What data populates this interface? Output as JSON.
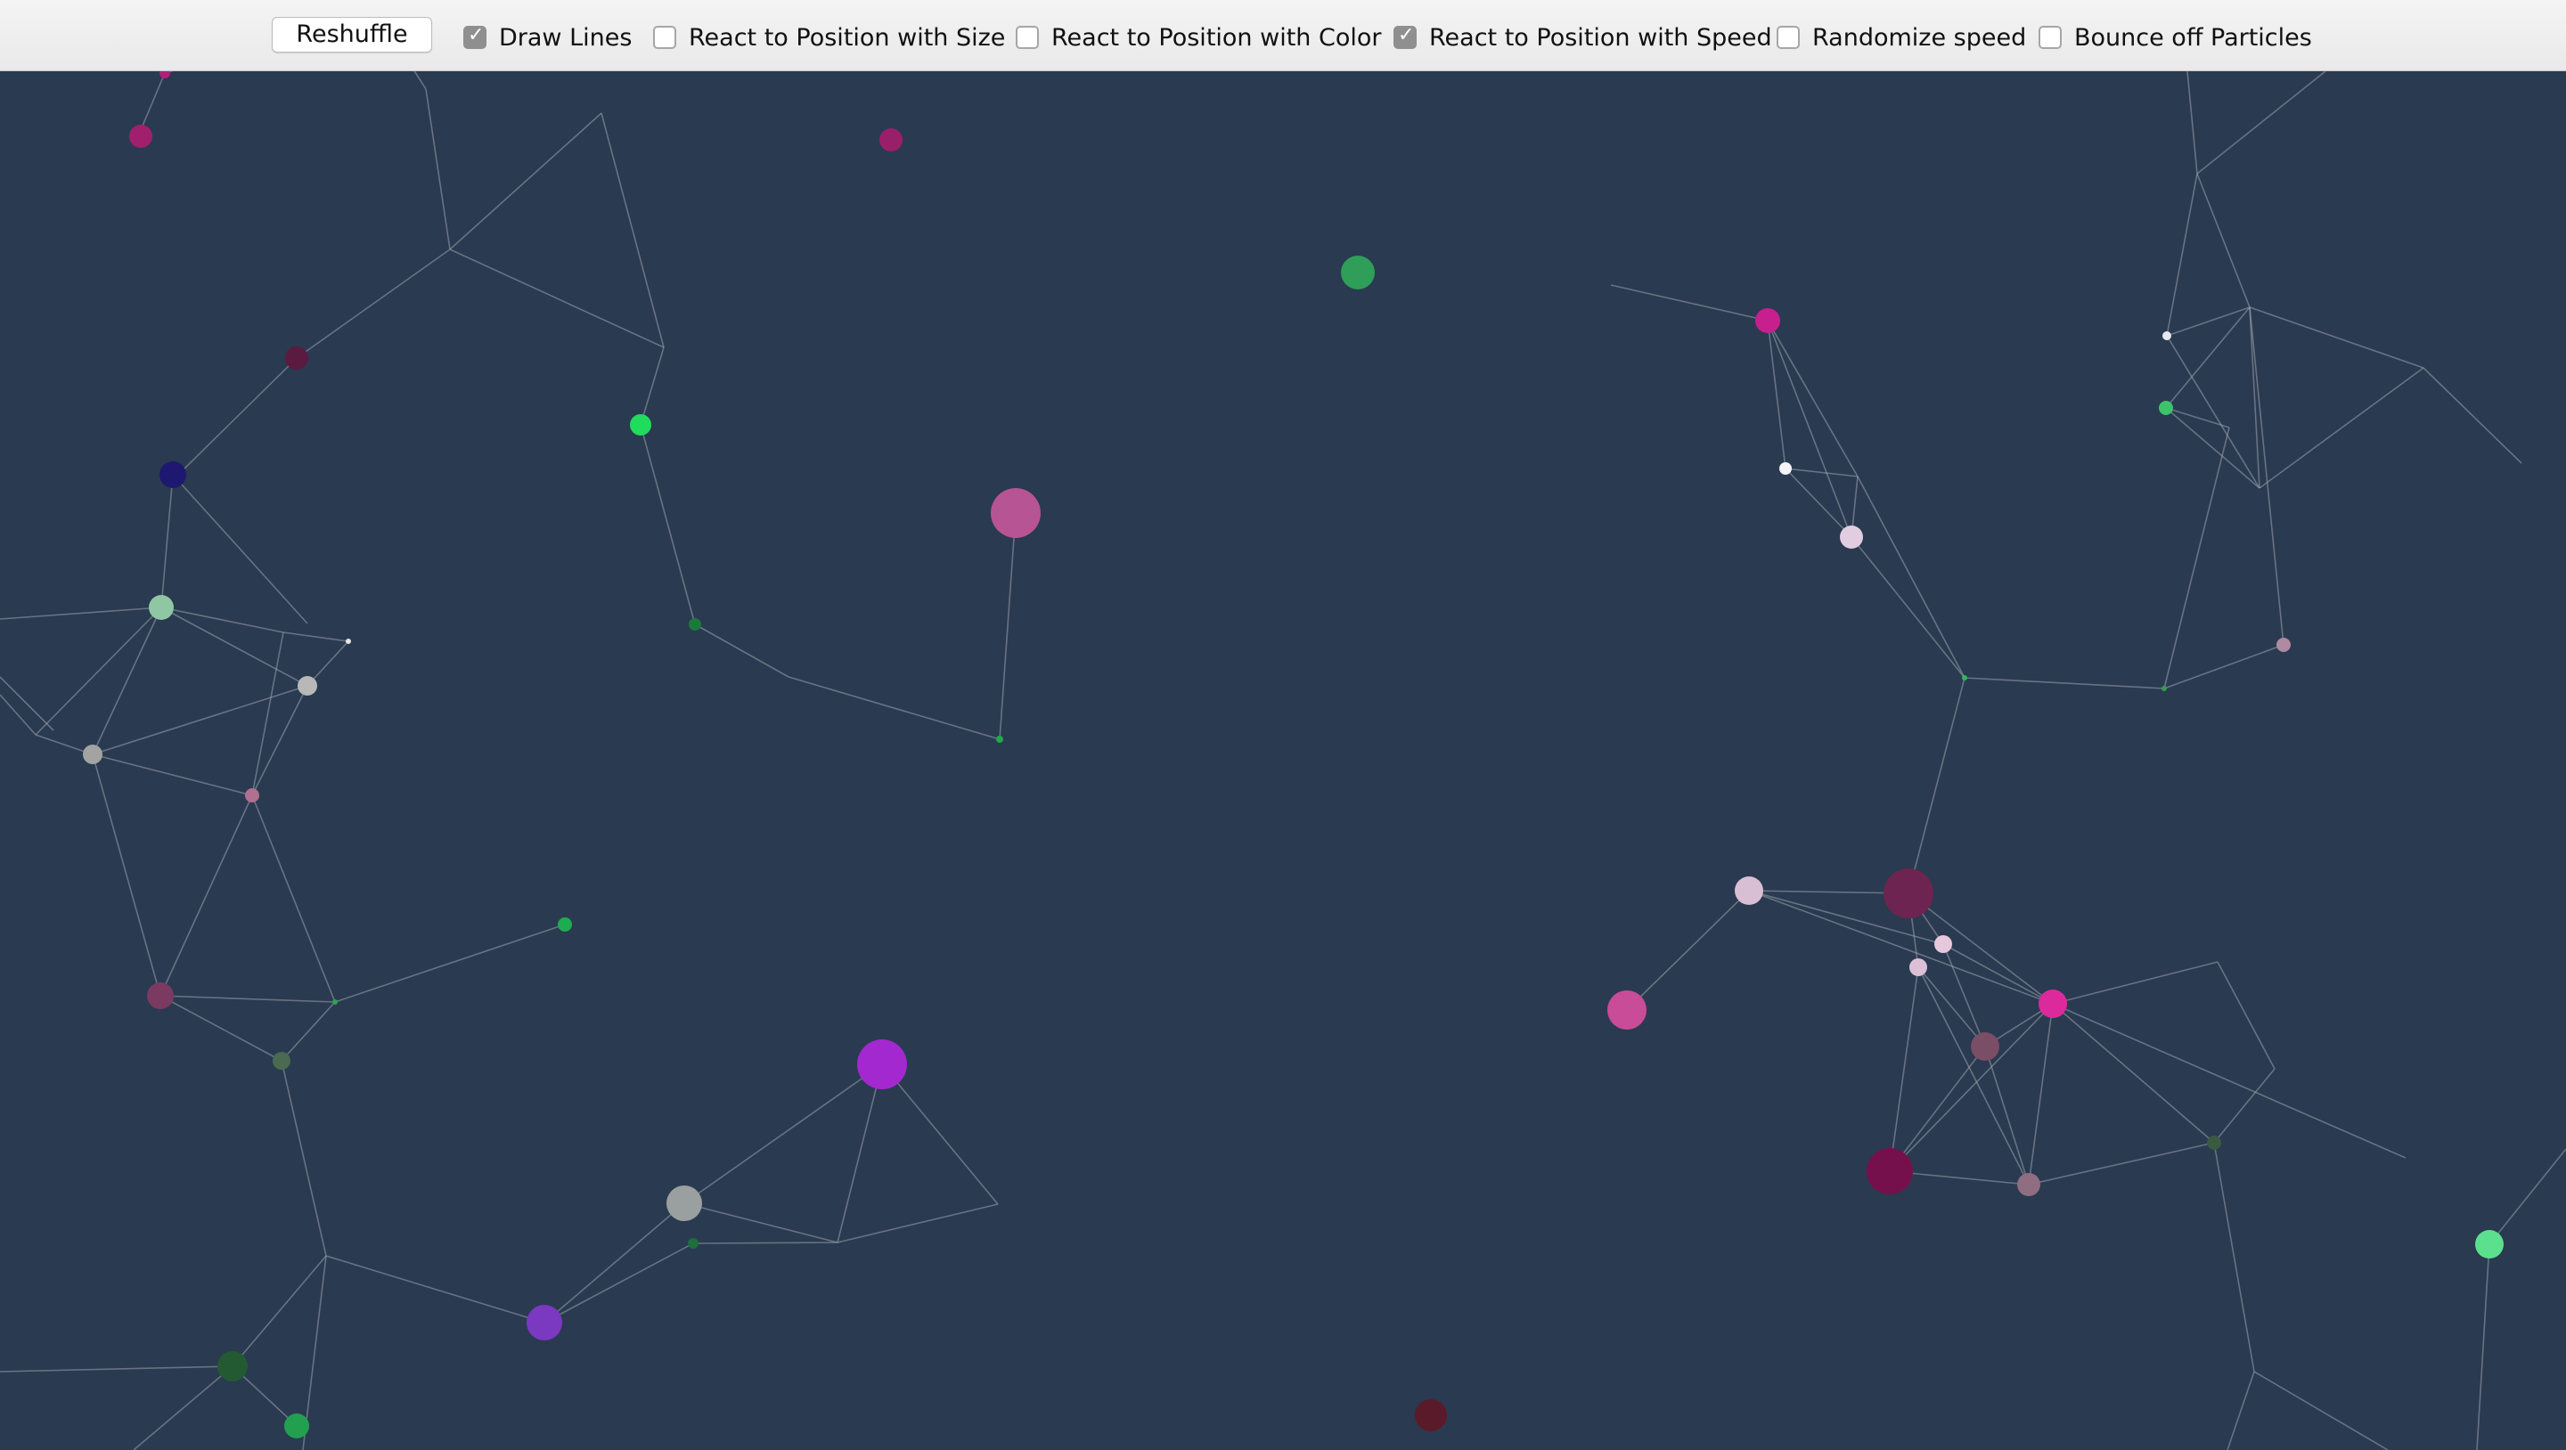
{
  "toolbar": {
    "reshuffle_label": "Reshuffle",
    "options": [
      {
        "label": "Draw Lines",
        "checked": true
      },
      {
        "label": "React to Position with Size",
        "checked": false
      },
      {
        "label": "React to Position with Color",
        "checked": false
      },
      {
        "label": "React to Position with Speed",
        "checked": true
      },
      {
        "label": "Randomize speed",
        "checked": false
      },
      {
        "label": "Bounce off Particles",
        "checked": false
      }
    ]
  },
  "canvas": {
    "background_color": "#2a3a50",
    "line_color": "#9aa3ad"
  }
}
